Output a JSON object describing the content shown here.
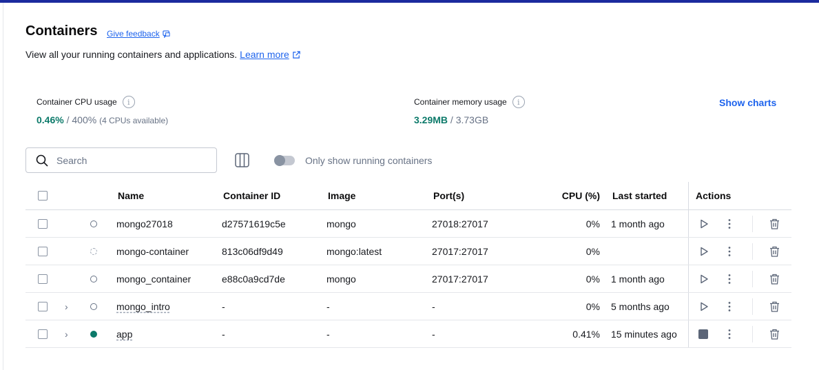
{
  "page": {
    "title": "Containers",
    "feedback_label": "Give feedback",
    "subtitle": "View all your running containers and applications.",
    "learn_more": "Learn more"
  },
  "stats": {
    "cpu": {
      "label": "Container CPU usage",
      "used": "0.46%",
      "total": "/ 400%",
      "note": "(4 CPUs available)"
    },
    "memory": {
      "label": "Container memory usage",
      "used": "3.29MB",
      "total": "/ 3.73GB"
    },
    "show_charts": "Show charts"
  },
  "toolbar": {
    "search_placeholder": "Search",
    "toggle_label": "Only show running containers",
    "toggle_on": false
  },
  "table": {
    "headers": {
      "name": "Name",
      "id": "Container ID",
      "image": "Image",
      "ports": "Port(s)",
      "cpu": "CPU (%)",
      "last_started": "Last started",
      "actions": "Actions"
    },
    "rows": [
      {
        "name": "mongo27018",
        "id": "d27571619c5e",
        "image": "mongo",
        "ports": "27018:27017",
        "cpu": "0%",
        "last_started": "1 month ago",
        "status": "stopped"
      },
      {
        "name": "mongo-container",
        "id": "813c06df9d49",
        "image": "mongo:latest",
        "ports": "27017:27017",
        "cpu": "0%",
        "last_started": "",
        "status": "created"
      },
      {
        "name": "mongo_container",
        "id": "e88c0a9cd7de",
        "image": "mongo",
        "ports": "27017:27017",
        "cpu": "0%",
        "last_started": "1 month ago",
        "status": "stopped"
      },
      {
        "name": "mongo_intro",
        "id": "-",
        "image": "-",
        "ports": "-",
        "cpu": "0%",
        "last_started": "5 months ago",
        "status": "stopped"
      },
      {
        "name": "app",
        "id": "-",
        "image": "-",
        "ports": "-",
        "cpu": "0.41%",
        "last_started": "15 minutes ago",
        "status": "running"
      }
    ]
  },
  "colors": {
    "accent": "#1d63ed",
    "running": "#0c7a6a",
    "topbar": "#1b2b9e"
  }
}
